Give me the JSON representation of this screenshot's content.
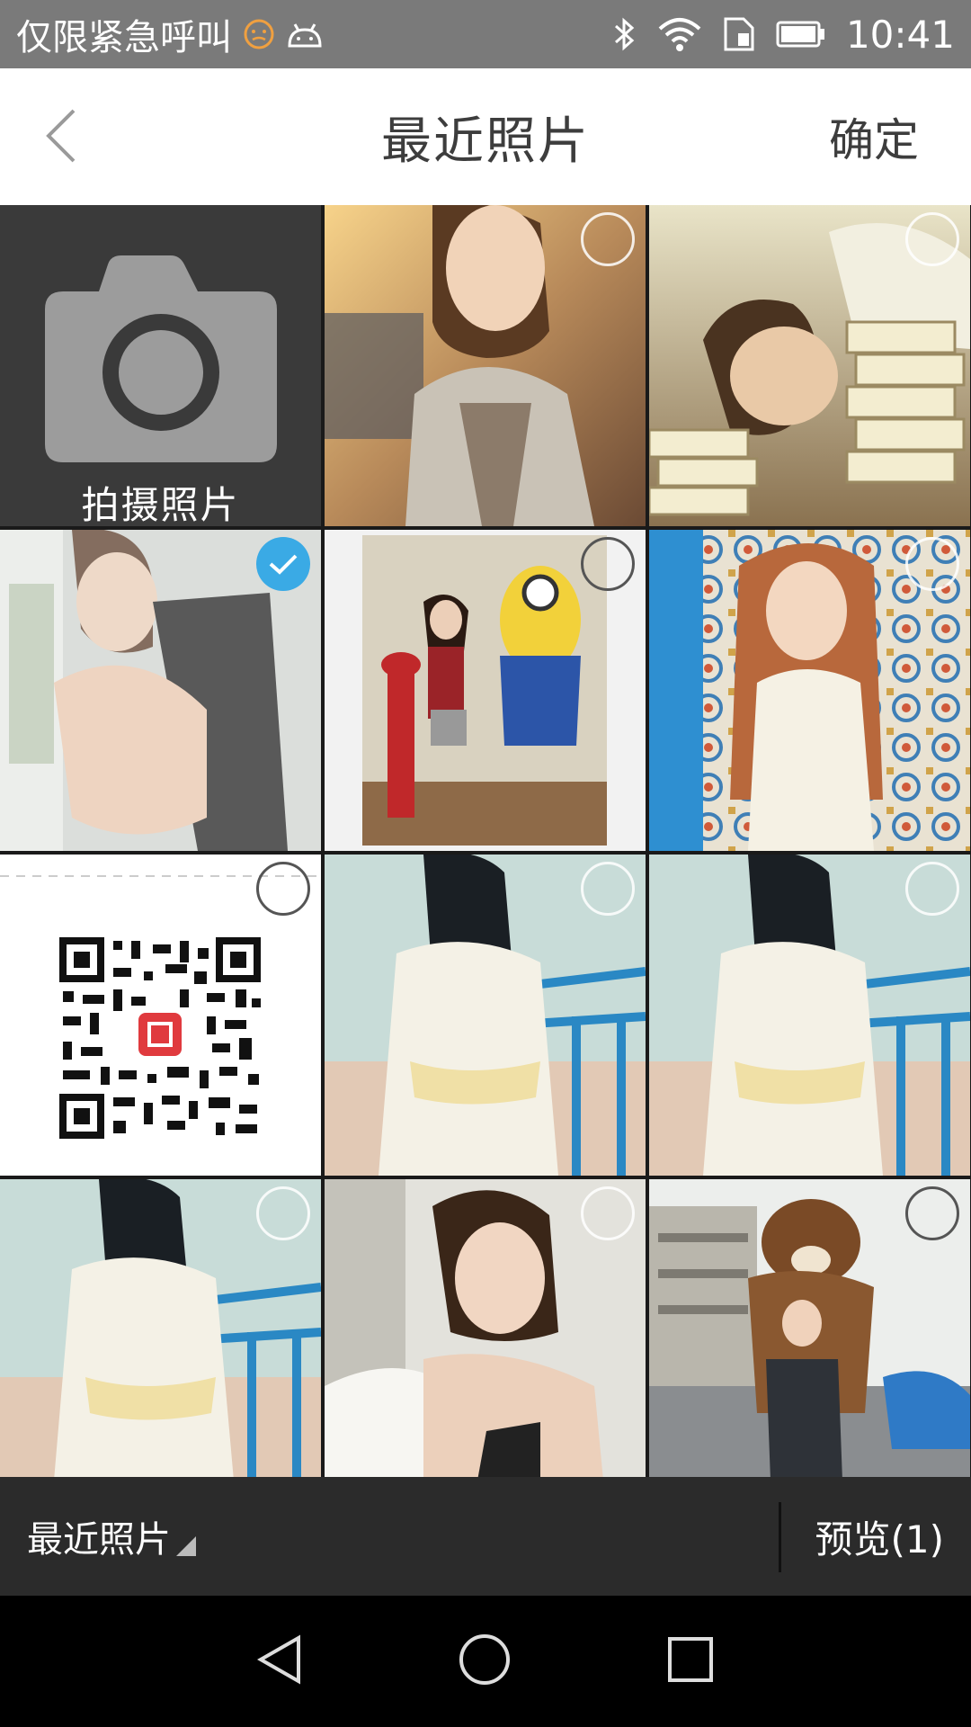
{
  "status_bar": {
    "carrier_text": "仅限紧急呼叫",
    "time": "10:41",
    "icons": [
      "face-icon",
      "android-icon",
      "bluetooth-icon",
      "wifi-icon",
      "sim-icon",
      "battery-icon"
    ]
  },
  "header": {
    "title": "最近照片",
    "confirm_label": "确定"
  },
  "grid": {
    "camera_label": "拍摄照片",
    "selected_count": 1
  },
  "bottom_bar": {
    "album_label": "最近照片",
    "preview_label": "预览(1)"
  },
  "colors": {
    "accent": "#3aaae5",
    "header_bg": "#ffffff",
    "bottom_bar_bg": "#2b2b2b",
    "status_bar_bg": "#7a7a7a"
  }
}
